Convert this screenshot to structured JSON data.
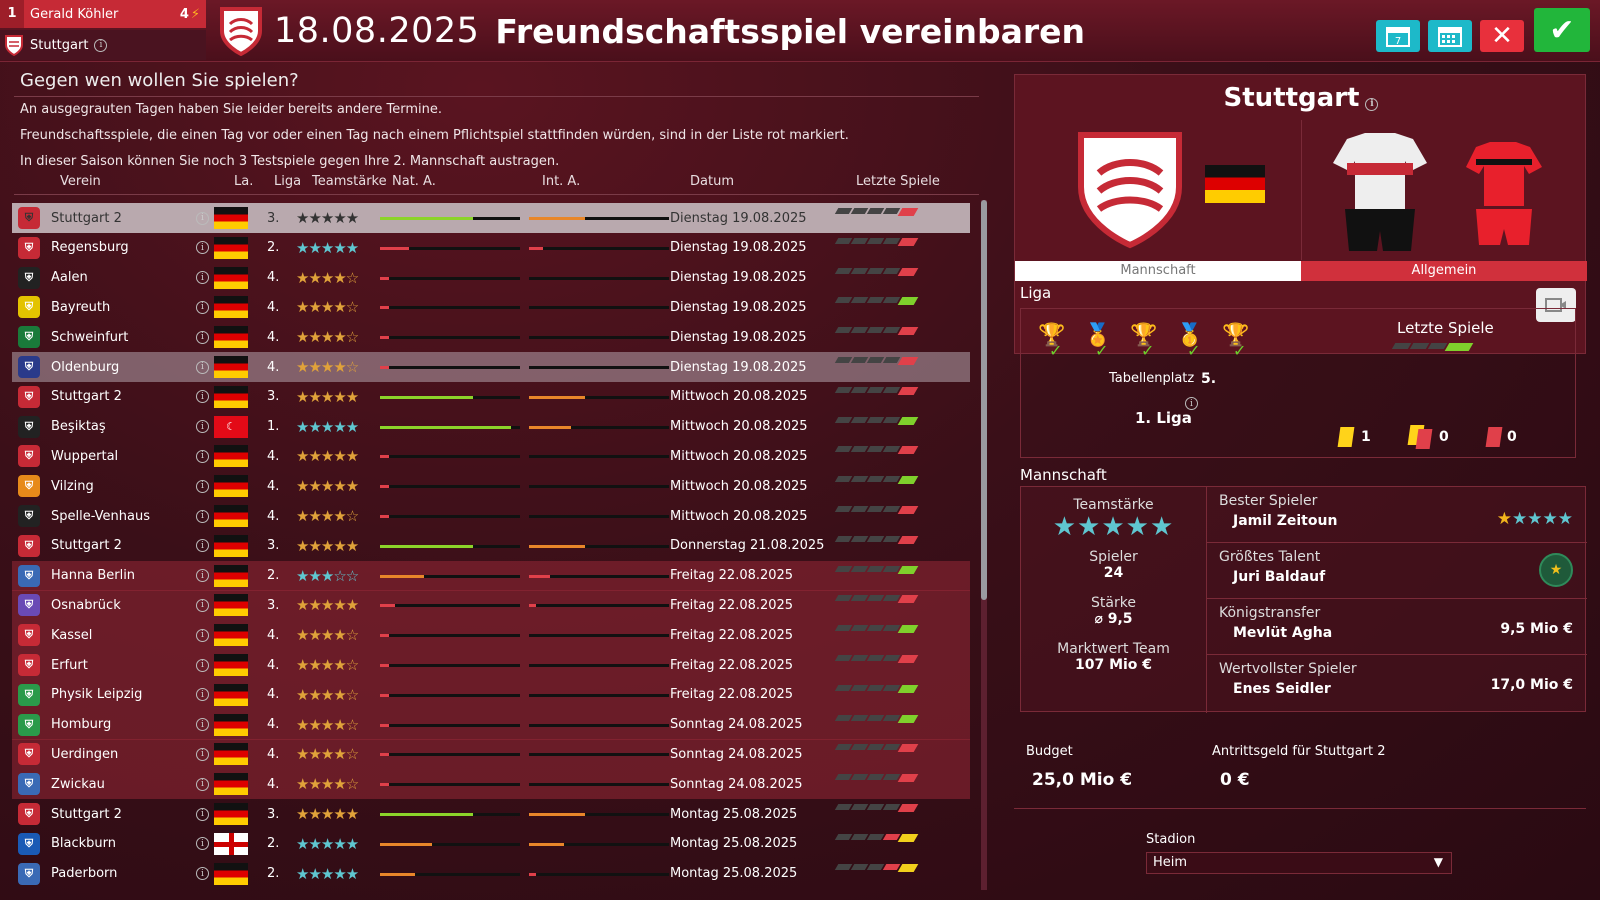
{
  "manager": {
    "number": "1",
    "name": "Gerald Köhler",
    "level": "4",
    "club": "Stuttgart"
  },
  "header": {
    "date": "18.08.2025",
    "title": "Freundschaftsspiel vereinbaren"
  },
  "left": {
    "question": "Gegen wen wollen Sie spielen?",
    "notes": [
      "An ausgegrauten Tagen haben Sie leider bereits andere Termine.",
      "Freundschaftsspiele, die einen Tag vor oder einen Tag nach einem Pflichtspiel stattfinden würden, sind in der Liste rot markiert.",
      "In dieser Saison können Sie noch 3 Testspiele gegen Ihre 2. Mannschaft austragen."
    ],
    "columns": {
      "club": "Verein",
      "country": "La.",
      "league": "Liga",
      "strength": "Teamstärke",
      "nat": "Nat. A.",
      "int": "Int. A.",
      "date": "Datum",
      "last": "Letzte Spiele"
    }
  },
  "rows": [
    {
      "club": "Stuttgart 2",
      "flag": "de",
      "league": "3.",
      "stars": 5,
      "nat": 0.32,
      "int": 0.4,
      "date": "Dienstag 19.08.2025",
      "state": "sel",
      "crest": "#c62a36",
      "last": "r"
    },
    {
      "club": "Regensburg",
      "flag": "de",
      "league": "2.",
      "stars": 4.5,
      "nat": 0.1,
      "int": 0.1,
      "date": "Dienstag 19.08.2025",
      "state": "",
      "crest": "#c62a36",
      "last": "r"
    },
    {
      "club": "Aalen",
      "flag": "de",
      "league": "4.",
      "stars": 3.5,
      "nat": 0.03,
      "int": 0,
      "date": "Dienstag 19.08.2025",
      "state": "",
      "crest": "#222",
      "last": "r"
    },
    {
      "club": "Bayreuth",
      "flag": "de",
      "league": "4.",
      "stars": 4,
      "nat": 0.03,
      "int": 0,
      "date": "Dienstag 19.08.2025",
      "state": "",
      "crest": "#e3c300",
      "last": "g"
    },
    {
      "club": "Schweinfurt",
      "flag": "de",
      "league": "4.",
      "stars": 4,
      "nat": 0.03,
      "int": 0,
      "date": "Dienstag 19.08.2025",
      "state": "",
      "crest": "#1a7a3a",
      "last": "r"
    },
    {
      "club": "Oldenburg",
      "flag": "de",
      "league": "4.",
      "stars": 4,
      "nat": 0.03,
      "int": 0,
      "date": "Dienstag 19.08.2025",
      "state": "hover",
      "crest": "#2a3a8a",
      "last": "r"
    },
    {
      "club": "Stuttgart 2",
      "flag": "de",
      "league": "3.",
      "stars": 5,
      "nat": 0.32,
      "int": 0.4,
      "date": "Mittwoch 20.08.2025",
      "state": "",
      "crest": "#c62a36",
      "last": "r"
    },
    {
      "club": "Beşiktaş",
      "flag": "tr",
      "league": "1.",
      "stars": 5,
      "nat": 0.45,
      "int": 0.3,
      "date": "Mittwoch 20.08.2025",
      "state": "",
      "crest": "#222",
      "last": "g"
    },
    {
      "club": "Wuppertal",
      "flag": "de",
      "league": "4.",
      "stars": 4.5,
      "nat": 0.03,
      "int": 0,
      "date": "Mittwoch 20.08.2025",
      "state": "",
      "crest": "#c62a36",
      "last": "r"
    },
    {
      "club": "Vilzing",
      "flag": "de",
      "league": "4.",
      "stars": 4.5,
      "nat": 0.03,
      "int": 0,
      "date": "Mittwoch 20.08.2025",
      "state": "",
      "crest": "#e78a1a",
      "last": "g"
    },
    {
      "club": "Spelle-Venhaus",
      "flag": "de",
      "league": "4.",
      "stars": 3.5,
      "nat": 0.03,
      "int": 0,
      "date": "Mittwoch 20.08.2025",
      "state": "",
      "crest": "#222",
      "last": "r"
    },
    {
      "club": "Stuttgart 2",
      "flag": "de",
      "league": "3.",
      "stars": 5,
      "nat": 0.32,
      "int": 0.4,
      "date": "Donnerstag 21.08.2025",
      "state": "",
      "crest": "#c62a36",
      "last": "r"
    },
    {
      "club": "Hanna Berlin",
      "flag": "de",
      "league": "2.",
      "stars": 3,
      "nat": 0.15,
      "int": 0.15,
      "date": "Freitag 22.08.2025",
      "state": "red",
      "crest": "#3a6ab5",
      "last": "g"
    },
    {
      "club": "Osnabrück",
      "flag": "de",
      "league": "3.",
      "stars": 4.5,
      "nat": 0.05,
      "int": 0.05,
      "date": "Freitag 22.08.2025",
      "state": "red",
      "crest": "#6a4ab5",
      "last": "r"
    },
    {
      "club": "Kassel",
      "flag": "de",
      "league": "4.",
      "stars": 4,
      "nat": 0.03,
      "int": 0,
      "date": "Freitag 22.08.2025",
      "state": "red",
      "crest": "#c62a36",
      "last": "g"
    },
    {
      "club": "Erfurt",
      "flag": "de",
      "league": "4.",
      "stars": 4,
      "nat": 0.03,
      "int": 0,
      "date": "Freitag 22.08.2025",
      "state": "red",
      "crest": "#c62a36",
      "last": "r"
    },
    {
      "club": "Physik Leipzig",
      "flag": "de",
      "league": "4.",
      "stars": 4,
      "nat": 0.03,
      "int": 0,
      "date": "Freitag 22.08.2025",
      "state": "red",
      "crest": "#2a9a4a",
      "last": "g"
    },
    {
      "club": "Homburg",
      "flag": "de",
      "league": "4.",
      "stars": 4,
      "nat": 0.03,
      "int": 0,
      "date": "Sonntag 24.08.2025",
      "state": "red",
      "crest": "#2a9a4a",
      "last": "g"
    },
    {
      "club": "Uerdingen",
      "flag": "de",
      "league": "4.",
      "stars": 4,
      "nat": 0.03,
      "int": 0,
      "date": "Sonntag 24.08.2025",
      "state": "red",
      "crest": "#c62a36",
      "last": "r"
    },
    {
      "club": "Zwickau",
      "flag": "de",
      "league": "4.",
      "stars": 4,
      "nat": 0.03,
      "int": 0,
      "date": "Sonntag 24.08.2025",
      "state": "red",
      "crest": "#3a6ab5",
      "last": "r"
    },
    {
      "club": "Stuttgart 2",
      "flag": "de",
      "league": "3.",
      "stars": 5,
      "nat": 0.32,
      "int": 0.4,
      "date": "Montag 25.08.2025",
      "state": "",
      "crest": "#c62a36",
      "last": "r"
    },
    {
      "club": "Blackburn",
      "flag": "en",
      "league": "2.",
      "stars": 4.5,
      "nat": 0.18,
      "int": 0.25,
      "date": "Montag 25.08.2025",
      "state": "",
      "crest": "#1a5ab5",
      "last": "y"
    },
    {
      "club": "Paderborn",
      "flag": "de",
      "league": "2.",
      "stars": 4.5,
      "nat": 0.12,
      "int": 0.05,
      "date": "Montag 25.08.2025",
      "state": "",
      "crest": "#3a6ab5",
      "last": "y"
    }
  ],
  "detail": {
    "club": "Stuttgart",
    "tab_team": "Mannschaft",
    "tab_general": "Allgemein",
    "liga_label": "Liga",
    "last_games_label": "Letzte Spiele",
    "table_pos_label": "Tabellenplatz",
    "table_pos": "5.",
    "league_name": "1. Liga",
    "cards_yellow": "1",
    "cards_yellowred": "0",
    "cards_red": "0",
    "team_label": "Mannschaft",
    "strength_label": "Teamstärke",
    "players_label": "Spieler",
    "players": "24",
    "power_label": "Stärke",
    "power": "⌀ 9,5",
    "market_label": "Marktwert Team",
    "market": "107 Mio €",
    "best_label": "Bester Spieler",
    "best": "Jamil Zeitoun",
    "talent_label": "Größtes Talent",
    "talent": "Juri Baldauf",
    "transfer_label": "Königstransfer",
    "transfer": "Mevlüt Agha",
    "transfer_val": "9,5 Mio €",
    "valuable_label": "Wertvollster Spieler",
    "valuable": "Enes Seidler",
    "valuable_val": "17,0 Mio €",
    "budget_label": "Budget",
    "budget": "25,0 Mio €",
    "fee_label": "Antrittsgeld für Stuttgart 2",
    "fee": "0 €",
    "stadium_label": "Stadion",
    "stadium": "Heim"
  },
  "colors": {
    "accent": "#c62a36",
    "nat": "#8cd42a",
    "int": "#e8862a",
    "win": "#7fd02c",
    "loss": "#e0404a"
  }
}
